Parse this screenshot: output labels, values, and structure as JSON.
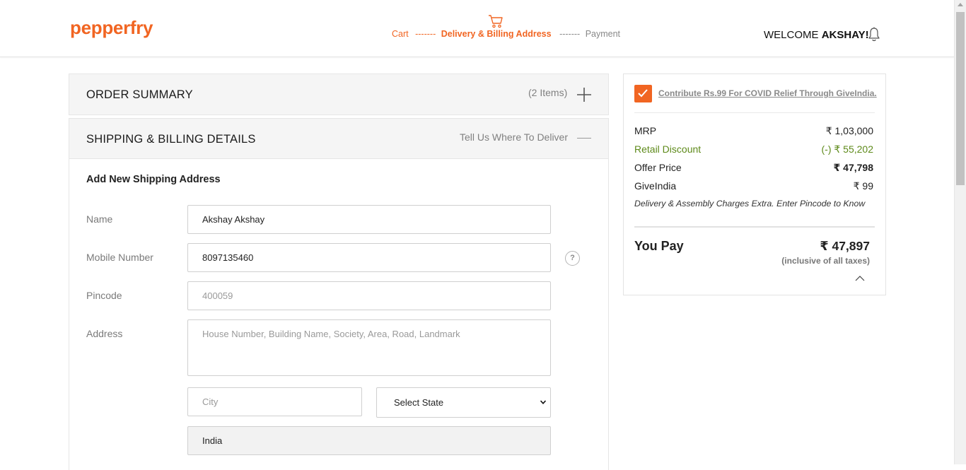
{
  "header": {
    "logo": "pepperfry",
    "steps": [
      {
        "label": "Cart",
        "state": "done"
      },
      {
        "label": "-------",
        "state": "sep-done"
      },
      {
        "label": "Delivery & Billing Address",
        "state": "active"
      },
      {
        "label": "-------",
        "state": "sep"
      },
      {
        "label": "Payment",
        "state": "pending"
      }
    ],
    "welcome_prefix": "WELCOME ",
    "welcome_name": "AKSHAY!",
    "icons": {
      "cart": "cart-icon",
      "notifications": "bell-icon"
    }
  },
  "colors": {
    "brand": "#f16522",
    "discount_green": "#5e8a1a",
    "muted": "#808080"
  },
  "order_summary": {
    "title": "ORDER SUMMARY",
    "items": "(2 Items)"
  },
  "shipping": {
    "title": "SHIPPING & BILLING DETAILS",
    "subtitle": "Tell Us Where To Deliver",
    "form_title": "Add New Shipping Address",
    "fields": {
      "name": {
        "label": "Name",
        "value": "Akshay Akshay"
      },
      "mobile": {
        "label": "Mobile Number",
        "value": "8097135460"
      },
      "pincode": {
        "label": "Pincode",
        "placeholder": "400059"
      },
      "address": {
        "label": "Address",
        "placeholder": "House Number, Building Name, Society, Area, Road, Landmark"
      },
      "city": {
        "placeholder": "City"
      },
      "state": {
        "selected": "Select State"
      },
      "country": {
        "value": "India"
      }
    },
    "help": "?"
  },
  "price_summary": {
    "give_india_link": "Contribute Rs.99 For COVID Relief Through GiveIndia.",
    "give_india_checked": true,
    "rows": [
      {
        "label": "MRP",
        "value": "₹ 1,03,000"
      },
      {
        "label": "Retail Discount",
        "value": "(-) ₹ 55,202"
      },
      {
        "label": "Offer Price",
        "value": "₹ 47,798"
      },
      {
        "label": "GiveIndia",
        "value": "₹ 99"
      }
    ],
    "note": "Delivery & Assembly Charges Extra. Enter Pincode to Know",
    "you_pay_label": "You Pay",
    "you_pay_value": "₹ 47,897",
    "taxes_note": "(inclusive of all taxes)"
  }
}
